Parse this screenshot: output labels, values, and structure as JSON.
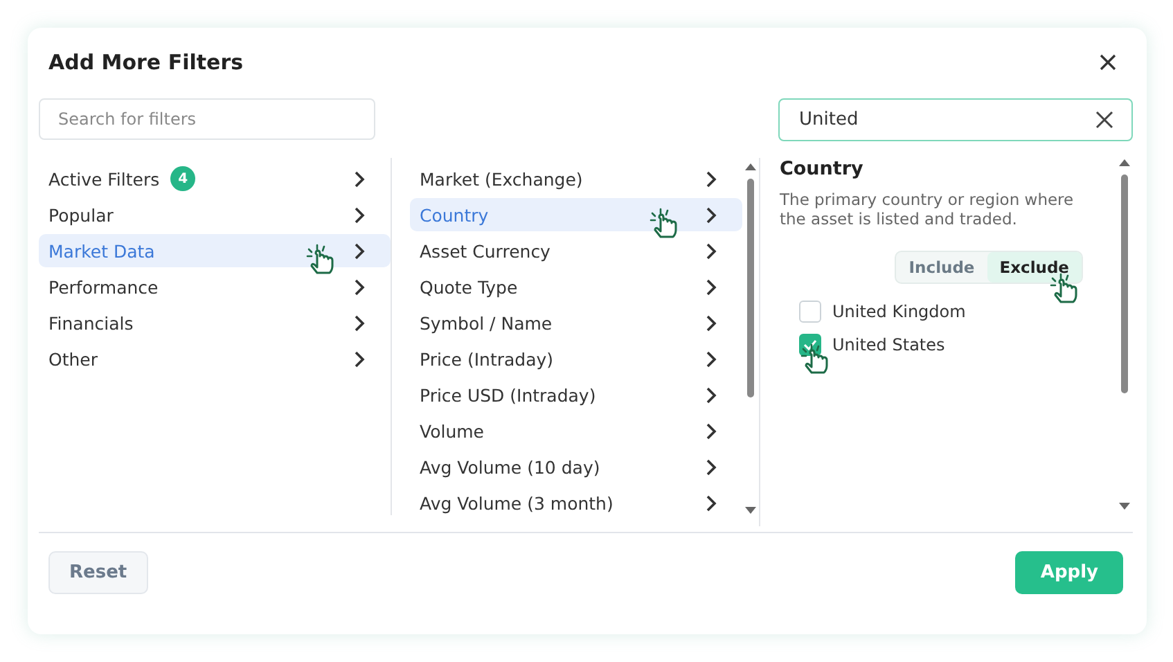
{
  "dialog": {
    "title": "Add More Filters"
  },
  "search": {
    "placeholder": "Search for filters"
  },
  "categories": [
    {
      "label": "Active Filters",
      "badge": "4",
      "selected": false
    },
    {
      "label": "Popular",
      "selected": false
    },
    {
      "label": "Market Data",
      "selected": true
    },
    {
      "label": "Performance",
      "selected": false
    },
    {
      "label": "Financials",
      "selected": false
    },
    {
      "label": "Other",
      "selected": false
    }
  ],
  "fields": [
    {
      "label": "Market (Exchange)",
      "selected": false
    },
    {
      "label": "Country",
      "selected": true
    },
    {
      "label": "Asset Currency",
      "selected": false
    },
    {
      "label": "Quote Type",
      "selected": false
    },
    {
      "label": "Symbol / Name",
      "selected": false
    },
    {
      "label": "Price (Intraday)",
      "selected": false
    },
    {
      "label": "Price USD (Intraday)",
      "selected": false
    },
    {
      "label": "Volume",
      "selected": false
    },
    {
      "label": "Avg Volume (10 day)",
      "selected": false
    },
    {
      "label": "Avg Volume (3 month)",
      "selected": false
    }
  ],
  "value_search": {
    "value": "United"
  },
  "detail": {
    "title": "Country",
    "description": "The primary country or region where the asset is listed and traded.",
    "modes": [
      {
        "label": "Include",
        "selected": false
      },
      {
        "label": "Exclude",
        "selected": true
      }
    ],
    "options": [
      {
        "label": "United Kingdom",
        "checked": false
      },
      {
        "label": "United States",
        "checked": true
      }
    ]
  },
  "buttons": {
    "reset": "Reset",
    "apply": "Apply"
  }
}
